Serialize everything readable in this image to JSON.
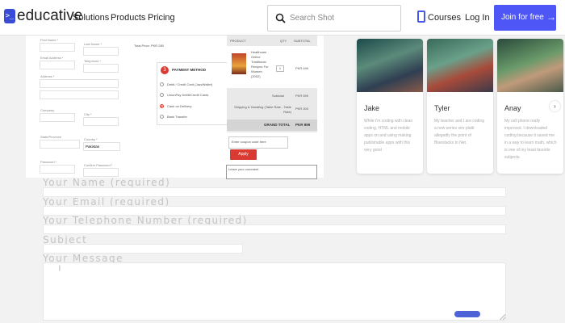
{
  "nav": {
    "logo_text": "educative",
    "links": [
      "Solutions",
      "Products",
      "Pricing"
    ],
    "search_placeholder": "Search Shot",
    "courses": "Courses",
    "login": "Log In",
    "join": "Join for free",
    "join_arrow": "→",
    "accent": "#4e56f5"
  },
  "checkout": {
    "fields": {
      "first_name": "First Name *",
      "last_name": "Last Name *",
      "email": "Email Address *",
      "telephone": "Telephone *",
      "address": "Address *",
      "company": "Company",
      "city": "City *",
      "state": "State/Province",
      "country": "Country *",
      "country_value": "Pakistan",
      "password": "Password *",
      "confirm_password": "Confirm Password *"
    },
    "total_row": "Total Price: PKR 280",
    "payment": {
      "badge": "3",
      "title": "PAYMENT METHOD",
      "options": [
        "Debit / Credit Card (JazzWallet)",
        "UnionPay Debit/Credit Cards",
        "Cash on Delivery",
        "Bank Transfer"
      ],
      "selected_index": 2
    },
    "order": {
      "headers": [
        "PRODUCT",
        "QTY",
        "SUBTOTAL"
      ],
      "product_name": "Healthcare Online Traditional Recipes For Women (2002)",
      "qty": "1",
      "product_price": "PKR 499",
      "subtotal_label": "Subtotal",
      "subtotal_value": "PKR 599",
      "shipping_label": "Shipping & Handling (Table Rate - Table Rate)",
      "shipping_value": "PKR 200",
      "grand_total_label": "GRAND TOTAL",
      "grand_total_value": "PKR 899"
    },
    "coupon_placeholder": "Enter coupon code here",
    "apply": "Apply",
    "comment_placeholder": "Leave your comment",
    "red": "#d93b33"
  },
  "testimonials": [
    {
      "name": "Jake",
      "quote": "While I'm coding with clean coding, HTML and mobile apps on and using making publishable apps with this very good"
    },
    {
      "name": "Tyler",
      "quote": "My teacher and I are coding a new series sim-platit allegedly the point of Bluestacks to Net."
    },
    {
      "name": "Anay",
      "quote": "My cell phone really improved. I downloaded coding because it saved me in a way to learn math, which is one of my least favorite subjects."
    }
  ],
  "testimonials_next": "›",
  "contact": {
    "name_label": "Your Name (required)",
    "email_label": "Your Email (required)",
    "phone_label": "Your Telephone Number (required)",
    "subject_label": "Subject",
    "message_label": "Your Message"
  }
}
